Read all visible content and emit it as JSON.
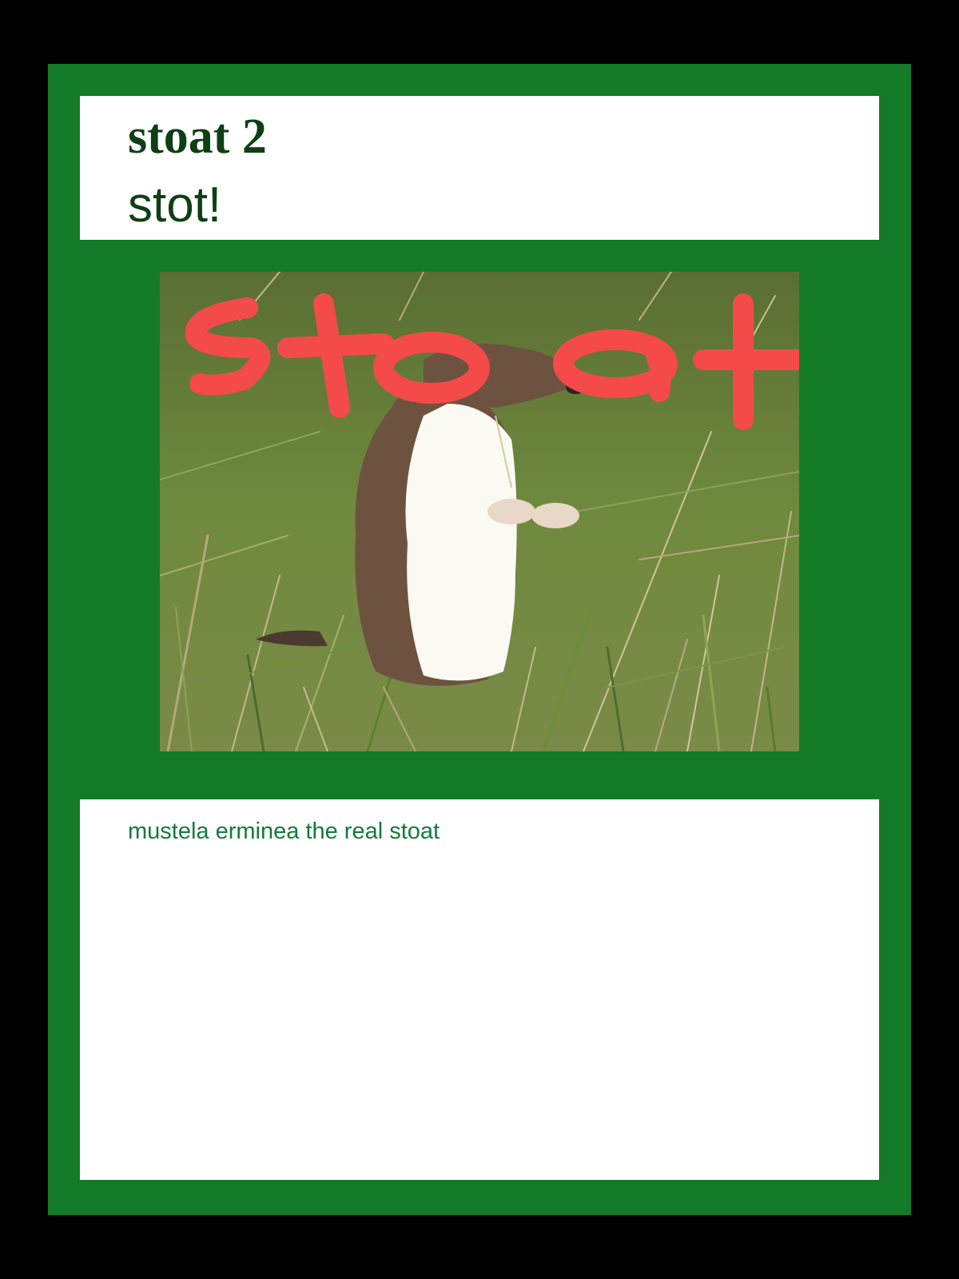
{
  "card": {
    "title": "stoat 2",
    "subtitle": "stot!",
    "description": "mustela erminea the real stoat",
    "image_overlay_text": "stoat"
  },
  "colors": {
    "page_background": "#000000",
    "card_green": "#137a28",
    "panel_white": "#ffffff",
    "title_text": "#0f3f14",
    "description_text": "#137a3c",
    "overlay_scribble": "#f44a4a",
    "stoat_brown": "#6e5240",
    "stoat_white": "#fbfaf2",
    "grass_green": "#66803a"
  },
  "icons": [
    "stoat-photo"
  ]
}
